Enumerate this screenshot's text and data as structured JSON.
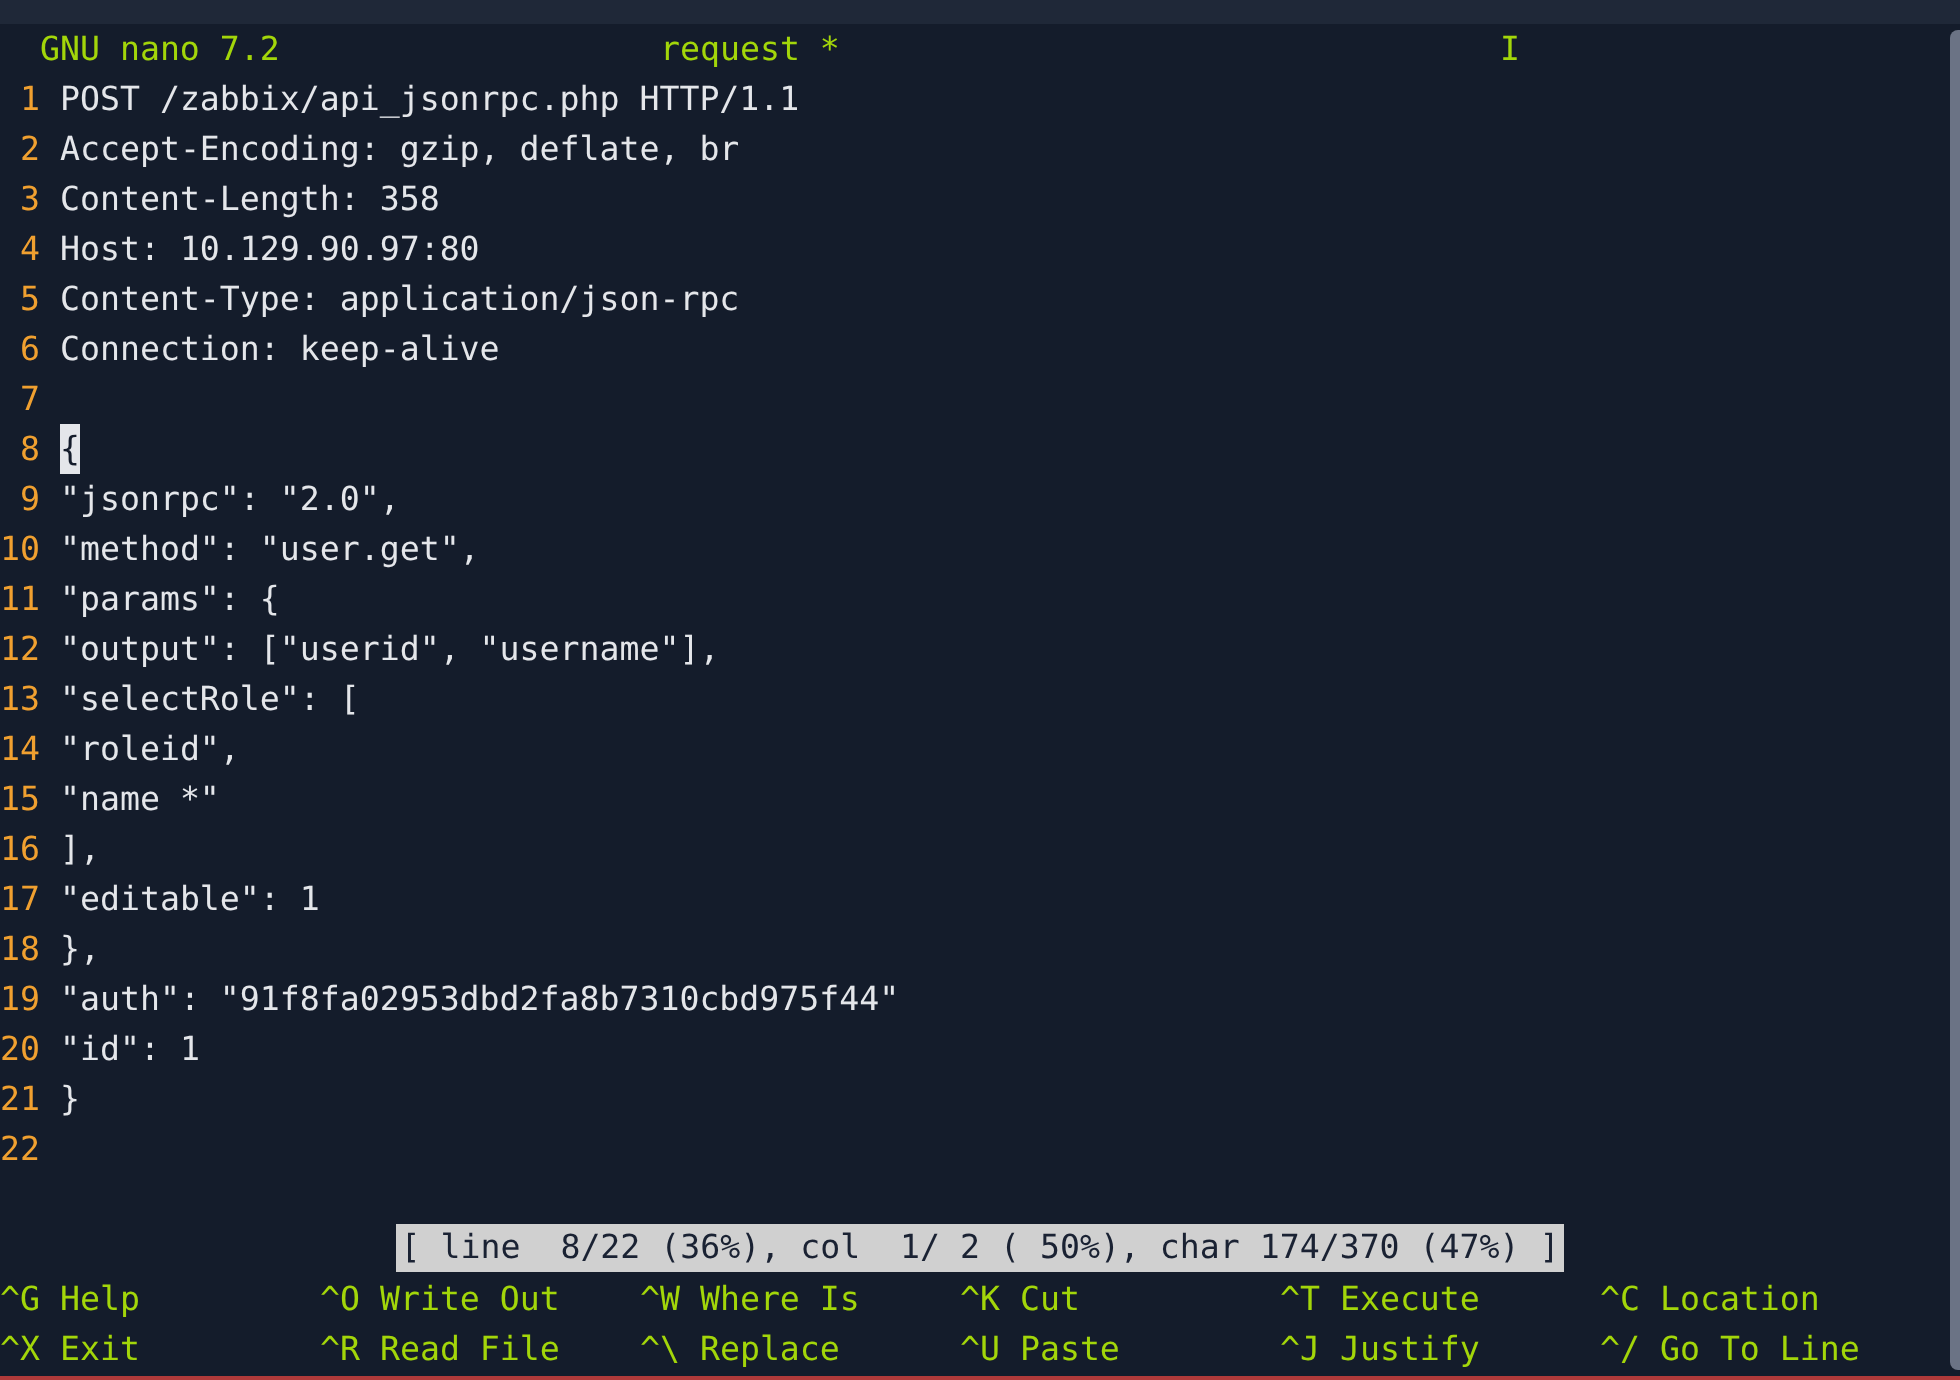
{
  "title_bar": {
    "app": "GNU nano 7.2",
    "filename": "request *",
    "indicator": "I"
  },
  "lines": [
    {
      "number": "1",
      "text": "POST /zabbix/api_jsonrpc.php HTTP/1.1",
      "cursor": false
    },
    {
      "number": "2",
      "text": "Accept-Encoding: gzip, deflate, br",
      "cursor": false
    },
    {
      "number": "3",
      "text": "Content-Length: 358",
      "cursor": false
    },
    {
      "number": "4",
      "text": "Host: 10.129.90.97:80",
      "cursor": false
    },
    {
      "number": "5",
      "text": "Content-Type: application/json-rpc",
      "cursor": false
    },
    {
      "number": "6",
      "text": "Connection: keep-alive",
      "cursor": false
    },
    {
      "number": "7",
      "cursor": false
    },
    {
      "number": "8",
      "text": "{",
      "cursor": true
    },
    {
      "number": "9",
      "text": "\"jsonrpc\": \"2.0\",",
      "cursor": false
    },
    {
      "number": "10",
      "text": "\"method\": \"user.get\",",
      "cursor": false
    },
    {
      "number": "11",
      "text": "\"params\": {",
      "cursor": false
    },
    {
      "number": "12",
      "text": "\"output\": [\"userid\", \"username\"],",
      "cursor": false
    },
    {
      "number": "13",
      "text": "\"selectRole\": [",
      "cursor": false
    },
    {
      "number": "14",
      "text": "\"roleid\",",
      "cursor": false
    },
    {
      "number": "15",
      "text": "\"name *\"",
      "cursor": false
    },
    {
      "number": "16",
      "text": "],",
      "cursor": false
    },
    {
      "number": "17",
      "text": "\"editable\": 1",
      "cursor": false
    },
    {
      "number": "18",
      "text": "},",
      "cursor": false
    },
    {
      "number": "19",
      "text": "\"auth\": \"91f8fa02953dbd2fa8b7310cbd975f44\"",
      "cursor": false
    },
    {
      "number": "20",
      "text": "\"id\": 1",
      "cursor": false
    },
    {
      "number": "21",
      "text": "}",
      "cursor": false
    },
    {
      "number": "22",
      "cursor": false
    }
  ],
  "status": "[ line  8/22 (36%), col  1/ 2 ( 50%), char 174/370 (47%) ]",
  "shortcuts": [
    [
      {
        "key": "^G",
        "label": "Help"
      },
      {
        "key": "^O",
        "label": "Write Out"
      },
      {
        "key": "^W",
        "label": "Where Is"
      },
      {
        "key": "^K",
        "label": "Cut"
      },
      {
        "key": "^T",
        "label": "Execute"
      },
      {
        "key": "^C",
        "label": "Location"
      }
    ],
    [
      {
        "key": "^X",
        "label": "Exit"
      },
      {
        "key": "^R",
        "label": "Read File"
      },
      {
        "key": "^\\",
        "label": "Replace"
      },
      {
        "key": "^U",
        "label": "Paste"
      },
      {
        "key": "^J",
        "label": "Justify"
      },
      {
        "key": "^/",
        "label": "Go To Line"
      }
    ]
  ]
}
